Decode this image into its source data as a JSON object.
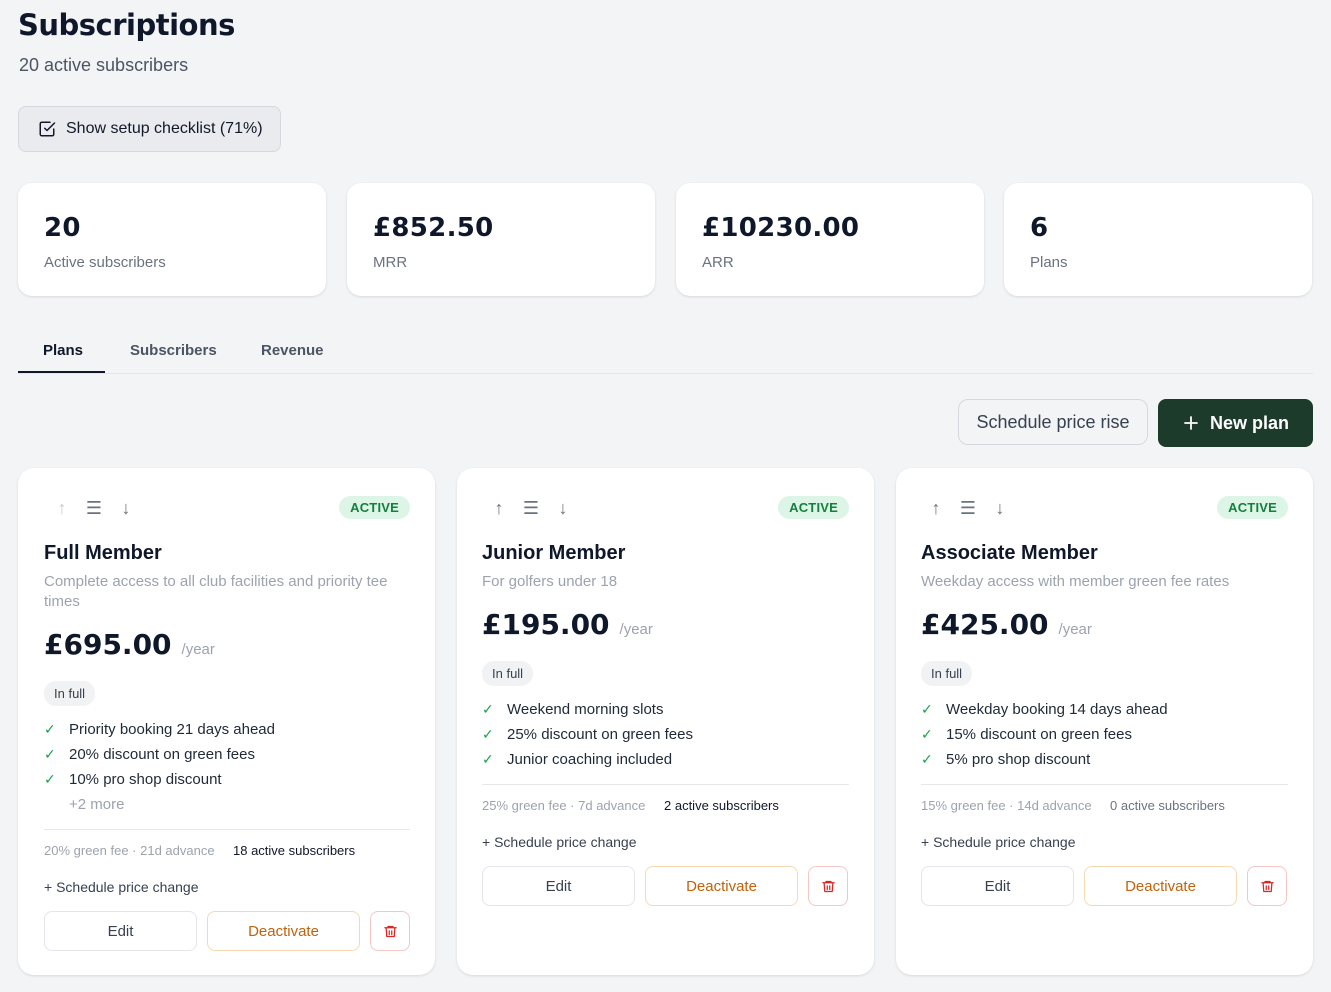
{
  "header": {
    "title": "Subscriptions",
    "subtitle": "20 active subscribers",
    "checklist_label": "Show setup checklist (71%)"
  },
  "stats": [
    {
      "value": "20",
      "label": "Active subscribers"
    },
    {
      "value": "£852.50",
      "label": "MRR"
    },
    {
      "value": "£10230.00",
      "label": "ARR"
    },
    {
      "value": "6",
      "label": "Plans"
    }
  ],
  "tabs": [
    {
      "label": "Plans",
      "active": true
    },
    {
      "label": "Subscribers",
      "active": false
    },
    {
      "label": "Revenue",
      "active": false
    }
  ],
  "actions": {
    "schedule_label": "Schedule price rise",
    "new_plan_label": "New plan"
  },
  "plans": [
    {
      "name": "Full Member",
      "description": "Complete access to all club facilities and priority tee times",
      "status": "ACTIVE",
      "price": "£695.00",
      "period": "/year",
      "payment": "In full",
      "features": [
        "Priority booking 21 days ahead",
        "20% discount on green fees",
        "10% pro shop discount"
      ],
      "more": "+2 more",
      "meta": "20% green fee · 21d advance",
      "subscribers": "18 active subscribers",
      "price_change": "+ Schedule price change",
      "edit_label": "Edit",
      "deactivate_label": "Deactivate"
    },
    {
      "name": "Junior Member",
      "description": "For golfers under 18",
      "status": "ACTIVE",
      "price": "£195.00",
      "period": "/year",
      "payment": "In full",
      "features": [
        "Weekend morning slots",
        "25% discount on green fees",
        "Junior coaching included"
      ],
      "meta": "25% green fee · 7d advance",
      "subscribers": "2 active subscribers",
      "price_change": "+ Schedule price change",
      "edit_label": "Edit",
      "deactivate_label": "Deactivate"
    },
    {
      "name": "Associate Member",
      "description": "Weekday access with member green fee rates",
      "status": "ACTIVE",
      "price": "£425.00",
      "period": "/year",
      "payment": "In full",
      "features": [
        "Weekday booking 14 days ahead",
        "15% discount on green fees",
        "5% pro shop discount"
      ],
      "meta": "15% green fee · 14d advance",
      "subscribers": "0 active subscribers",
      "price_change": "+ Schedule price change",
      "edit_label": "Edit",
      "deactivate_label": "Deactivate"
    }
  ],
  "colors": {
    "primary": "#1c3b2b",
    "active_badge_bg": "#dcf5e7",
    "active_badge_text": "#15803d",
    "deactivate": "#c2620c",
    "delete": "#dc2626"
  }
}
